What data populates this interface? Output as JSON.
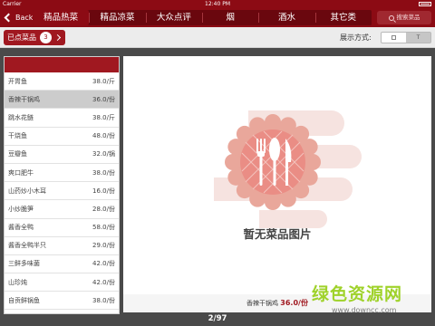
{
  "status": {
    "carrier": "Carrier",
    "time": "12:40 PM"
  },
  "nav": {
    "back_label": "Back",
    "tabs": [
      {
        "label": "精品热菜"
      },
      {
        "label": "精品凉菜"
      },
      {
        "label": "大众点评"
      },
      {
        "label": "烟"
      },
      {
        "label": "酒水"
      },
      {
        "label": "其它类"
      }
    ],
    "active_tab": "精品热菜",
    "search_placeholder": "搜索菜品"
  },
  "toolbar": {
    "ordered_label": "已点菜品",
    "ordered_count": "3",
    "display_mode_label": "展示方式:",
    "display_mode_selected": "T"
  },
  "dishes": [
    {
      "name": "开胃鱼",
      "price": "38.0/斤"
    },
    {
      "name": "香辣干锅鸡",
      "price": "36.0/份"
    },
    {
      "name": "跳水花鲢",
      "price": "38.0/斤"
    },
    {
      "name": "干烧鱼",
      "price": "48.0/份"
    },
    {
      "name": "豆瓣鱼",
      "price": "32.0/锅"
    },
    {
      "name": "爽口肥牛",
      "price": "38.0/份"
    },
    {
      "name": "山药炒小木耳",
      "price": "16.0/份"
    },
    {
      "name": "小炒脆笋",
      "price": "28.0/份"
    },
    {
      "name": "酱香全鸭",
      "price": "58.0/份"
    },
    {
      "name": "酱香全鸭半只",
      "price": "29.0/份"
    },
    {
      "name": "三鲜多味菌",
      "price": "42.0/份"
    },
    {
      "name": "山珍炖",
      "price": "42.0/份"
    },
    {
      "name": "自贡鲜锅鱼",
      "price": "38.0/份"
    }
  ],
  "selected_dish_index": 1,
  "detail": {
    "empty_text": "暂无菜品图片",
    "caption_name": "香辣干锅鸡",
    "caption_price": "36.0/份"
  },
  "pager": "2/97",
  "watermark": {
    "text": "绿色资源网",
    "url": "www.downcc.com"
  },
  "colors": {
    "brand_red": "#8c0b14",
    "accent_red": "#a01820",
    "placeholder_pink": "#e9a79b",
    "watermark_green": "#9fd22a"
  }
}
